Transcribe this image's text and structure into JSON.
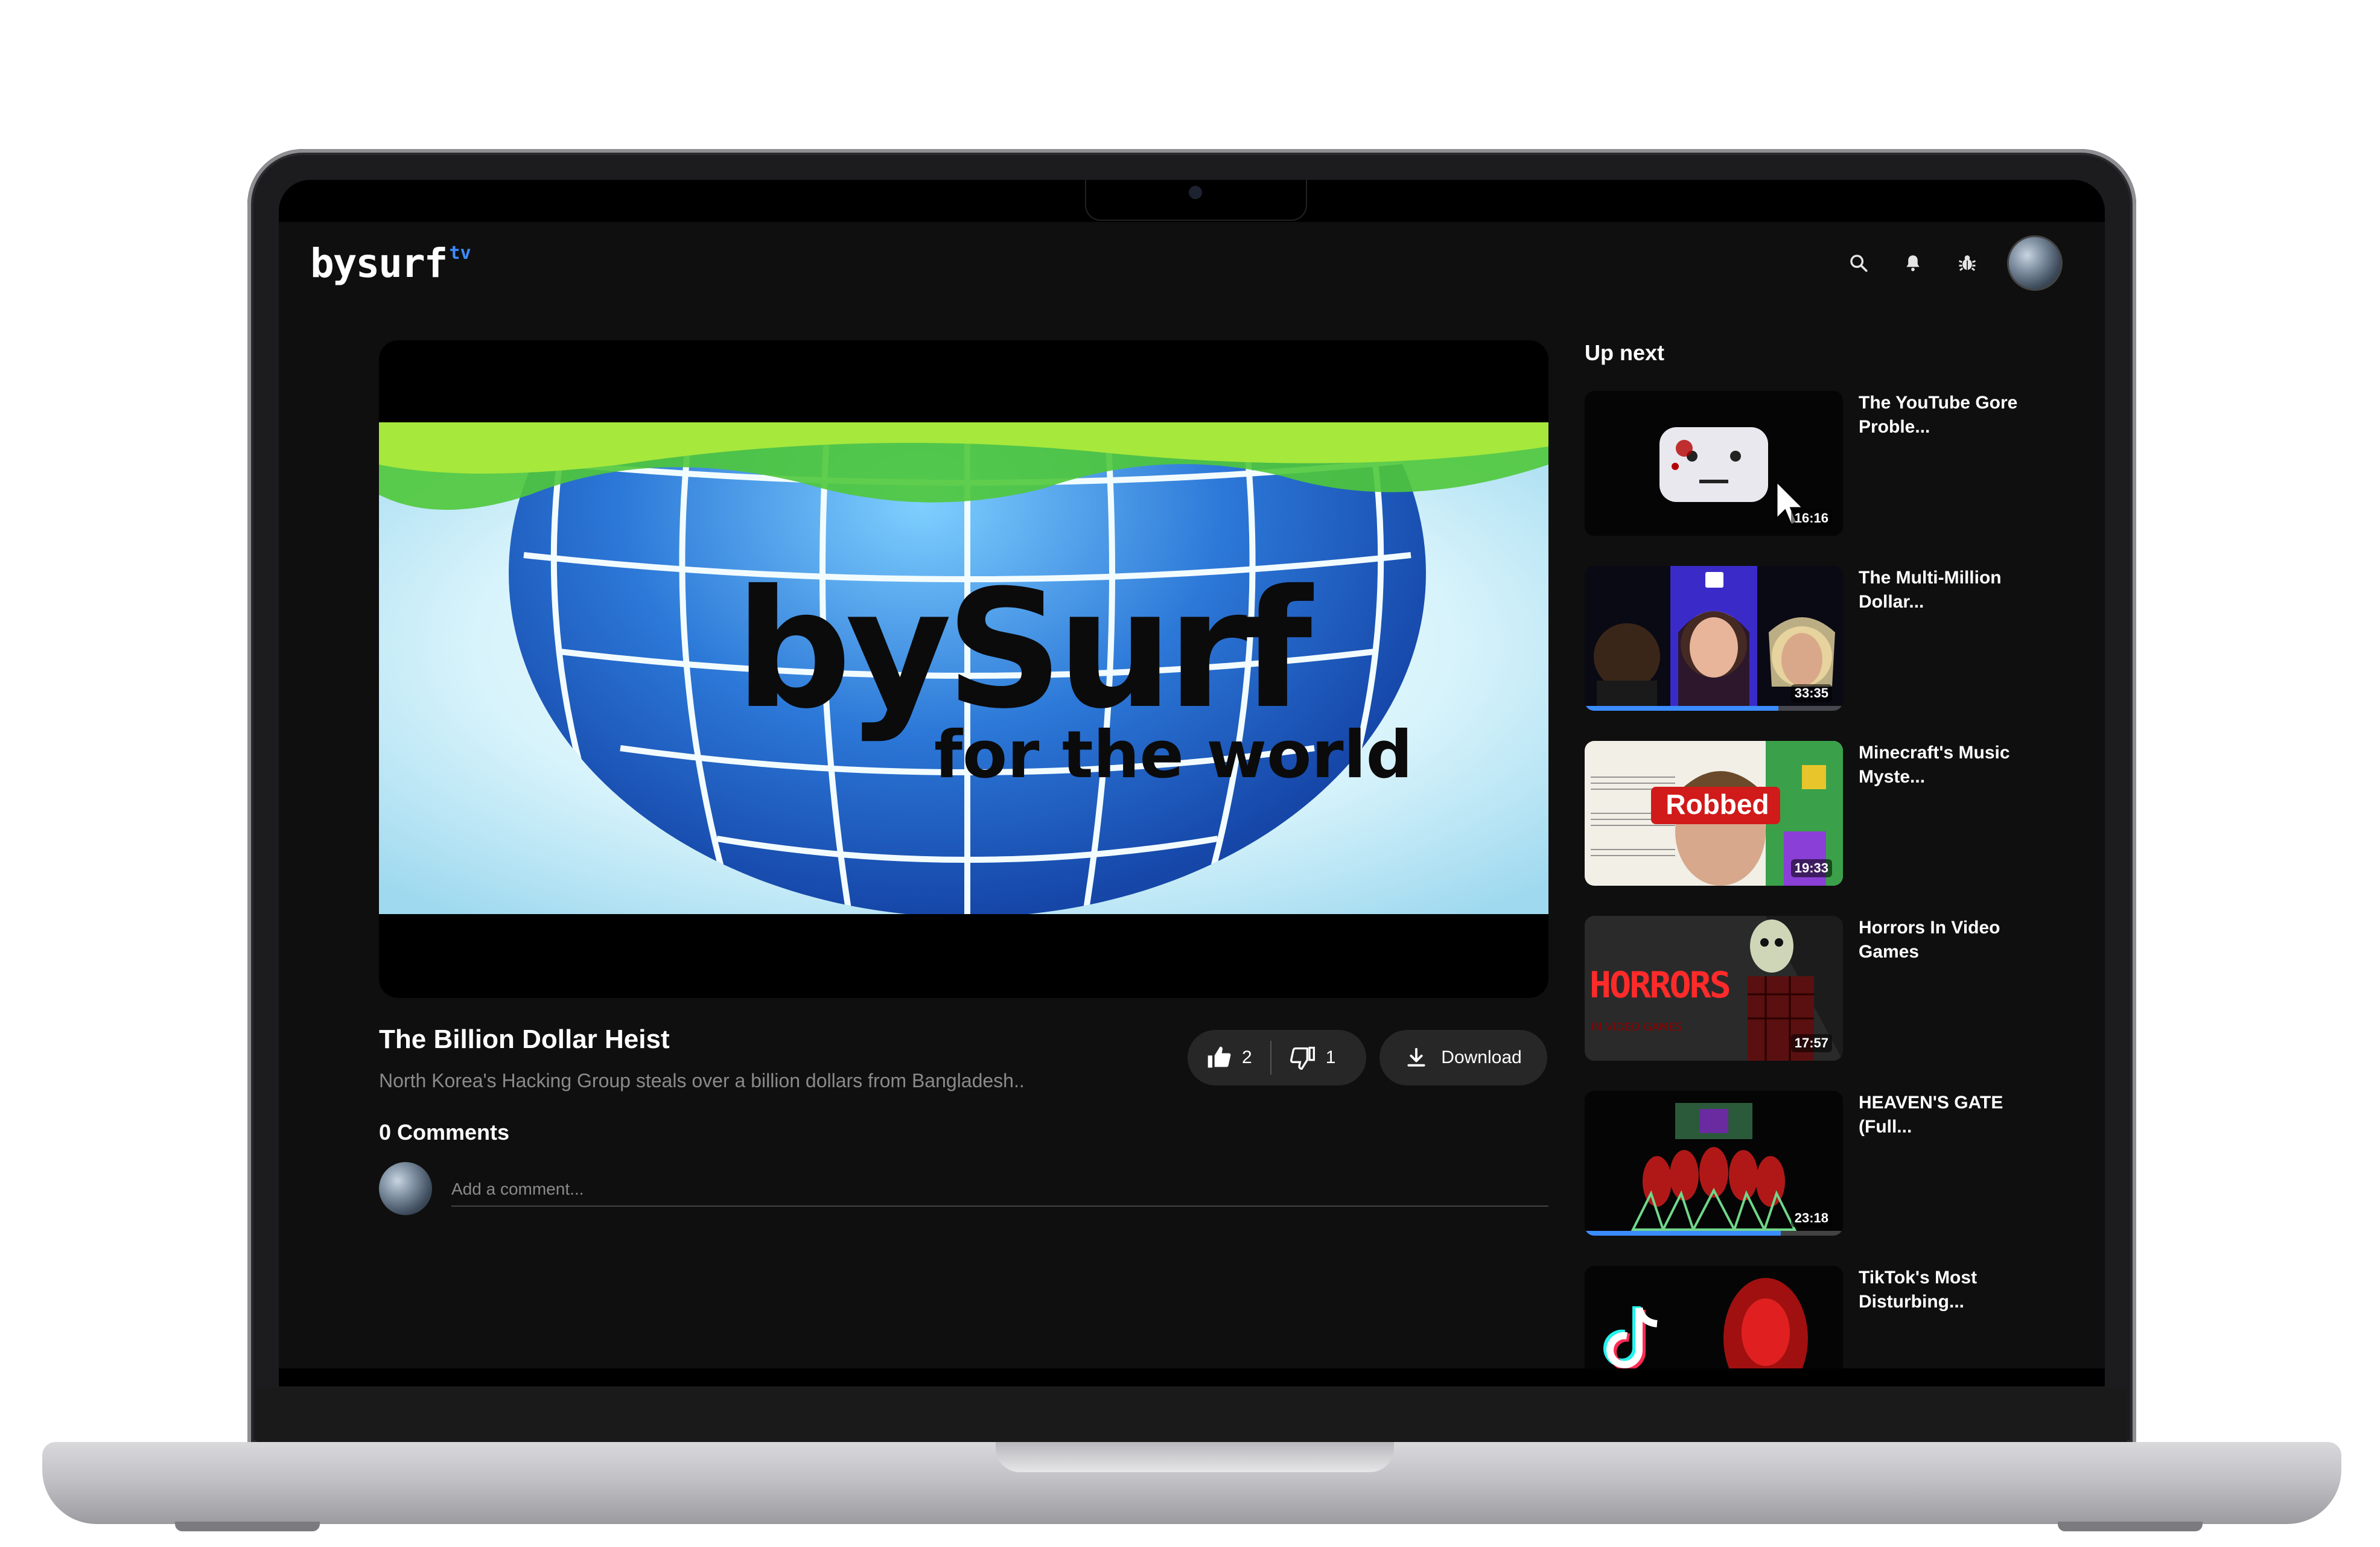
{
  "app": {
    "logo_text": "bysurf",
    "logo_suffix": "tv"
  },
  "header": {
    "icons": [
      "search-icon",
      "bell-icon",
      "bug-icon"
    ],
    "avatar": "user-avatar"
  },
  "video": {
    "overlay_line1": "bySurf",
    "overlay_line2": "for the world",
    "title": "The Billion Dollar Heist",
    "description": "North Korea's Hacking Group steals over a billion dollars from Bangladesh..",
    "likes": "2",
    "dislikes": "1",
    "download_label": "Download"
  },
  "comments": {
    "heading": "0 Comments",
    "placeholder": "Add a comment..."
  },
  "up_next": {
    "heading": "Up next",
    "items": [
      {
        "title": "The YouTube Gore Proble...",
        "duration": "16:16",
        "progress": 0
      },
      {
        "title": "The Multi-Million Dollar...",
        "duration": "33:35",
        "progress": 0.75
      },
      {
        "title": "Minecraft's Music Myste...",
        "duration": "19:33",
        "progress": 0,
        "thumb_text": "Robbed"
      },
      {
        "title": "Horrors In Video Games",
        "duration": "17:57",
        "progress": 0,
        "thumb_text": "HORRORS"
      },
      {
        "title": "HEAVEN'S GATE (Full...",
        "duration": "23:18",
        "progress": 0.76
      },
      {
        "title": "TikTok's Most Disturbing...",
        "duration": "",
        "progress": 0
      }
    ]
  },
  "colors": {
    "accent": "#3b8cff",
    "background": "#0f0f0f",
    "pill": "#272727"
  }
}
